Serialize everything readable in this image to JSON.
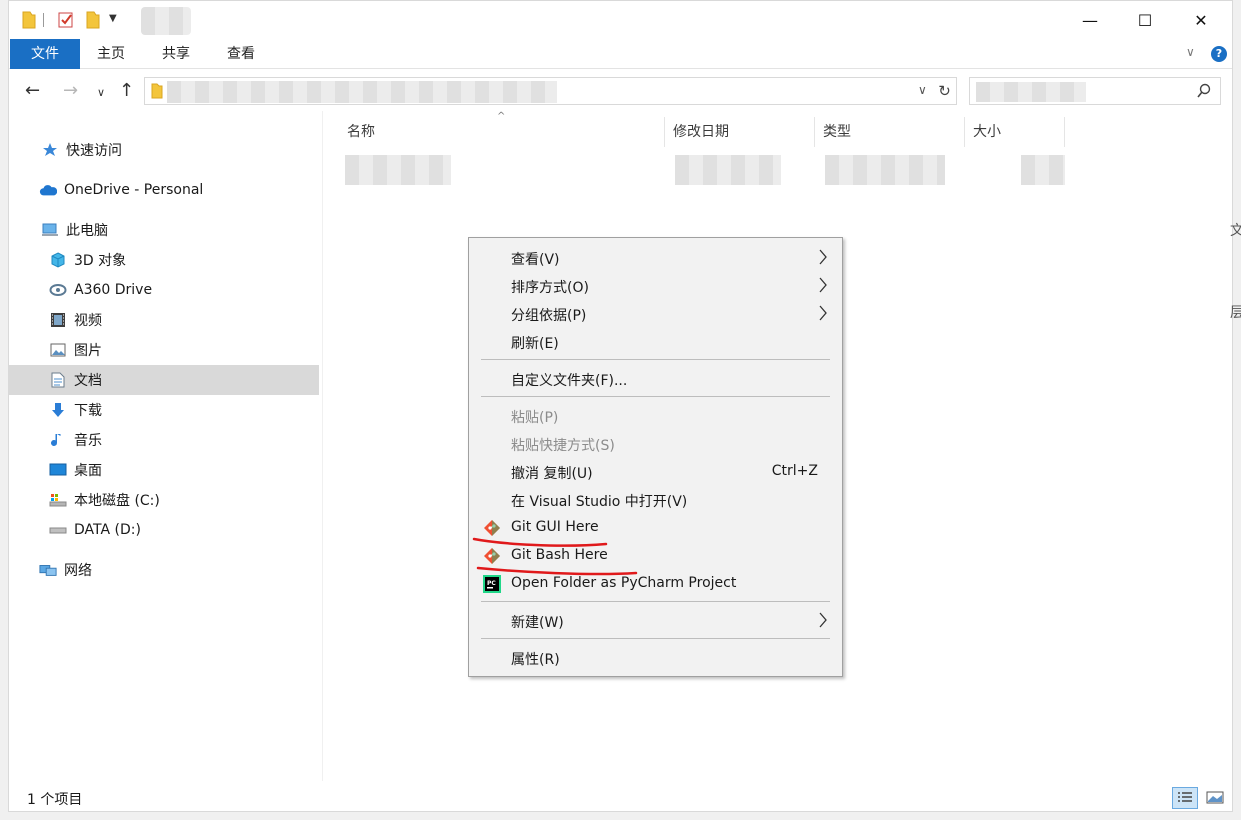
{
  "ribbon": {
    "file": "文件",
    "home": "主页",
    "share": "共享",
    "view": "查看",
    "help": "?"
  },
  "window_controls": {
    "minimize": "—",
    "maximize": "☐",
    "close": "✕"
  },
  "nav": {
    "back": "←",
    "forward": "→",
    "recent": "∨",
    "up": "↑",
    "refresh": "↻"
  },
  "sidebar": {
    "items": [
      {
        "label": "快速访问",
        "icon": "star-icon"
      },
      {
        "label": "OneDrive - Personal",
        "icon": "cloud-icon"
      },
      {
        "label": "此电脑",
        "icon": "computer-icon"
      },
      {
        "label": "3D 对象",
        "icon": "cube-icon"
      },
      {
        "label": "A360 Drive",
        "icon": "a360-drive-icon"
      },
      {
        "label": "视频",
        "icon": "video-icon"
      },
      {
        "label": "图片",
        "icon": "picture-icon"
      },
      {
        "label": "文档",
        "icon": "document-icon",
        "selected": true
      },
      {
        "label": "下载",
        "icon": "download-icon"
      },
      {
        "label": "音乐",
        "icon": "music-icon"
      },
      {
        "label": "桌面",
        "icon": "desktop-icon"
      },
      {
        "label": "本地磁盘 (C:)",
        "icon": "drive-c-icon"
      },
      {
        "label": "DATA (D:)",
        "icon": "drive-d-icon"
      },
      {
        "label": "网络",
        "icon": "network-icon"
      }
    ]
  },
  "columns": {
    "name": "名称",
    "modified": "修改日期",
    "type": "类型",
    "size": "大小"
  },
  "status": {
    "count": "1 个项目"
  },
  "edge_glyphs": {
    "a": "文",
    "b": "层"
  },
  "context_menu": {
    "view": "查看(V)",
    "sort": "排序方式(O)",
    "group": "分组依据(P)",
    "refresh": "刷新(E)",
    "customize": "自定义文件夹(F)...",
    "paste": "粘贴(P)",
    "paste_shortcut": "粘贴快捷方式(S)",
    "undo": "撤消 复制(U)",
    "undo_shortcut": "Ctrl+Z",
    "open_vs": "在 Visual Studio 中打开(V)",
    "git_gui": "Git GUI Here",
    "git_bash": "Git Bash Here",
    "pycharm": "Open Folder as PyCharm Project",
    "new": "新建(W)",
    "properties": "属性(R)",
    "submenu_arrow": "›"
  },
  "colors": {
    "accent": "#1a6fc4",
    "annotation": "#e0191b",
    "git": "#f05033"
  }
}
